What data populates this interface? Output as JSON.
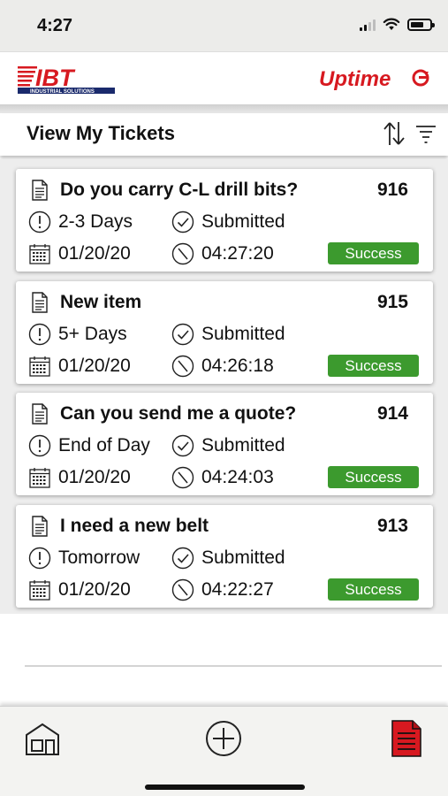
{
  "status_bar": {
    "time": "4:27"
  },
  "brand": {
    "left_logo_text": "IBT",
    "left_logo_subtext": "INDUSTRIAL SOLUTIONS",
    "right_logo_text": "Uptime",
    "accent_color": "#d71920"
  },
  "header": {
    "title": "View My Tickets"
  },
  "tickets": [
    {
      "title": "Do you carry C-L drill bits?",
      "number": "916",
      "urgency": "2-3 Days",
      "status": "Submitted",
      "date": "01/20/20",
      "time": "04:27:20",
      "badge": "Success"
    },
    {
      "title": "New item",
      "number": "915",
      "urgency": "5+ Days",
      "status": "Submitted",
      "date": "01/20/20",
      "time": "04:26:18",
      "badge": "Success"
    },
    {
      "title": "Can you send me a quote?",
      "number": "914",
      "urgency": "End of Day",
      "status": "Submitted",
      "date": "01/20/20",
      "time": "04:24:03",
      "badge": "Success"
    },
    {
      "title": "I need a new belt",
      "number": "913",
      "urgency": "Tomorrow",
      "status": "Submitted",
      "date": "01/20/20",
      "time": "04:22:27",
      "badge": "Success"
    }
  ],
  "colors": {
    "success": "#3c9a2e",
    "active_tab": "#d71920"
  },
  "tabs": [
    {
      "icon": "home-icon"
    },
    {
      "icon": "plus-circle-icon"
    },
    {
      "icon": "document-icon",
      "active": true
    }
  ]
}
